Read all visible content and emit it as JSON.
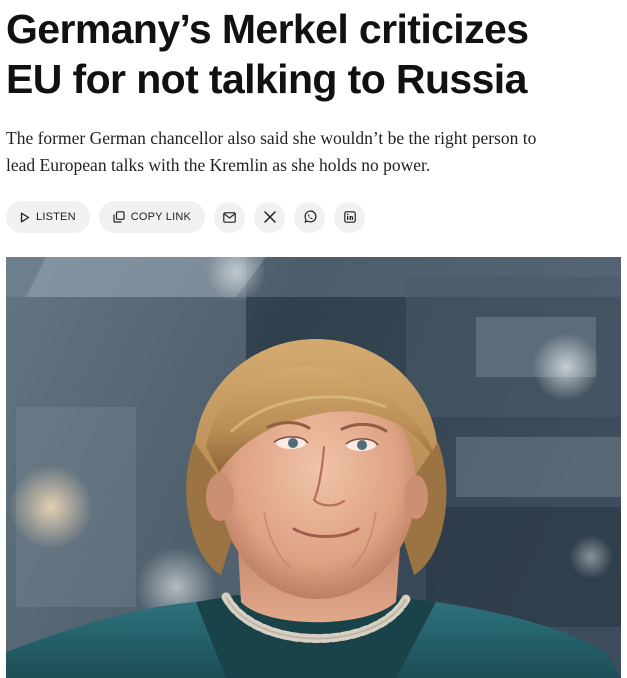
{
  "article": {
    "headline_line1": "Germany’s Merkel criticizes",
    "headline_line2": "EU for not talking to Russia",
    "dek_line1": "The former German chancellor also said she wouldn’t be the right person to",
    "dek_line2": "lead European talks with the Kremlin as she holds no power."
  },
  "toolbar": {
    "listen_label": "LISTEN",
    "copy_link_label": "COPY LINK",
    "icons": [
      "play-icon",
      "copy-icon",
      "email-icon",
      "x-icon",
      "whatsapp-icon",
      "linkedin-icon"
    ]
  },
  "colors": {
    "text": "#111111",
    "pill_bg": "#f1f1f1",
    "jacket": "#2a6770",
    "hair": "#b98d55"
  }
}
